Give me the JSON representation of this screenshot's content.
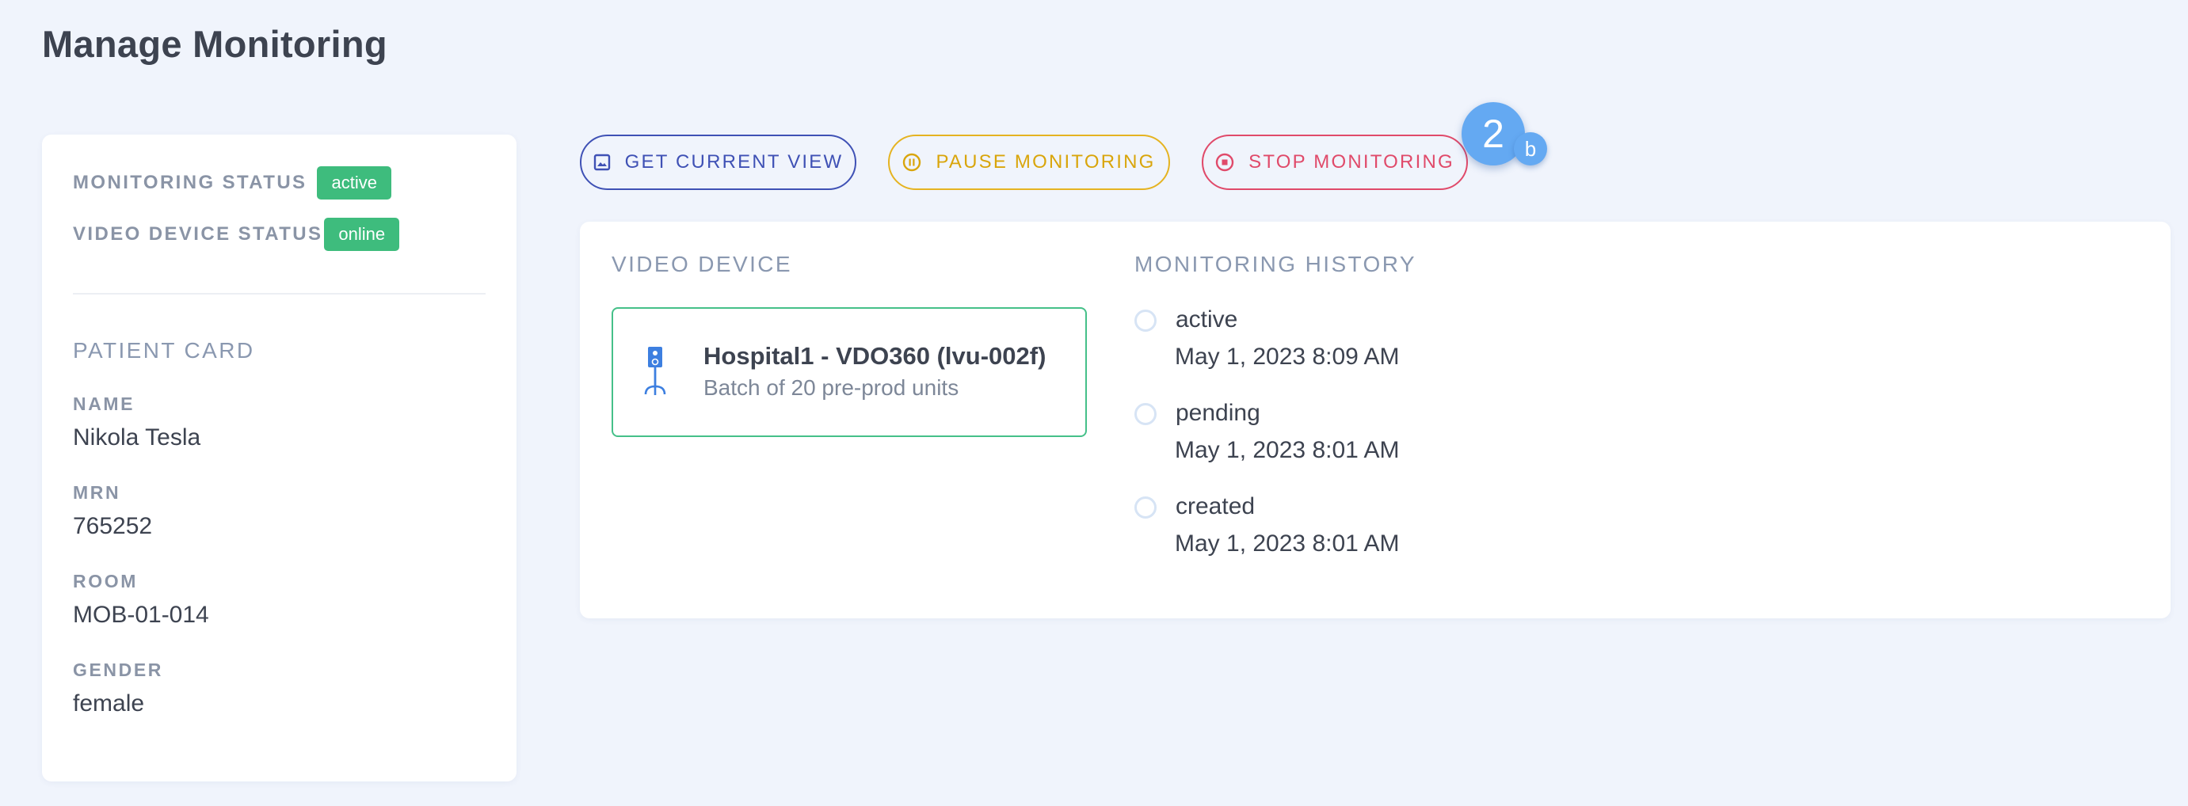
{
  "page": {
    "title": "Manage Monitoring"
  },
  "status": {
    "monitoring_label": "MONITORING STATUS",
    "monitoring_value": "active",
    "video_device_label": "VIDEO DEVICE STATUS",
    "video_device_value": "online"
  },
  "patient_card": {
    "title": "PATIENT CARD",
    "fields": [
      {
        "label": "NAME",
        "value": "Nikola Tesla"
      },
      {
        "label": "MRN",
        "value": "765252"
      },
      {
        "label": "ROOM",
        "value": "MOB-01-014"
      },
      {
        "label": "GENDER",
        "value": "female"
      }
    ]
  },
  "actions": {
    "get_current_view": {
      "label": "GET CURRENT VIEW",
      "icon": "image-icon"
    },
    "pause_monitoring": {
      "label": "PAUSE MONITORING",
      "icon": "pause-circle-icon"
    },
    "stop_monitoring": {
      "label": "STOP MONITORING",
      "icon": "stop-circle-icon"
    }
  },
  "step_marker": {
    "number": "2",
    "sub": "b"
  },
  "video_device": {
    "title": "VIDEO DEVICE",
    "name": "Hospital1 - VDO360 (lvu-002f)",
    "description": "Batch of 20 pre-prod units",
    "icon": "camera-stand-icon"
  },
  "monitoring_history": {
    "title": "MONITORING HISTORY",
    "items": [
      {
        "status": "active",
        "time": "May 1, 2023 8:09 AM"
      },
      {
        "status": "pending",
        "time": "May 1, 2023 8:01 AM"
      },
      {
        "status": "created",
        "time": "May 1, 2023 8:01 AM"
      }
    ]
  },
  "colors": {
    "background": "#f0f4fc",
    "success": "#3ebc7d",
    "primary": "#3f51b5",
    "warning": "#e5b321",
    "danger": "#e04a6a",
    "marker": "#64a9f2"
  }
}
